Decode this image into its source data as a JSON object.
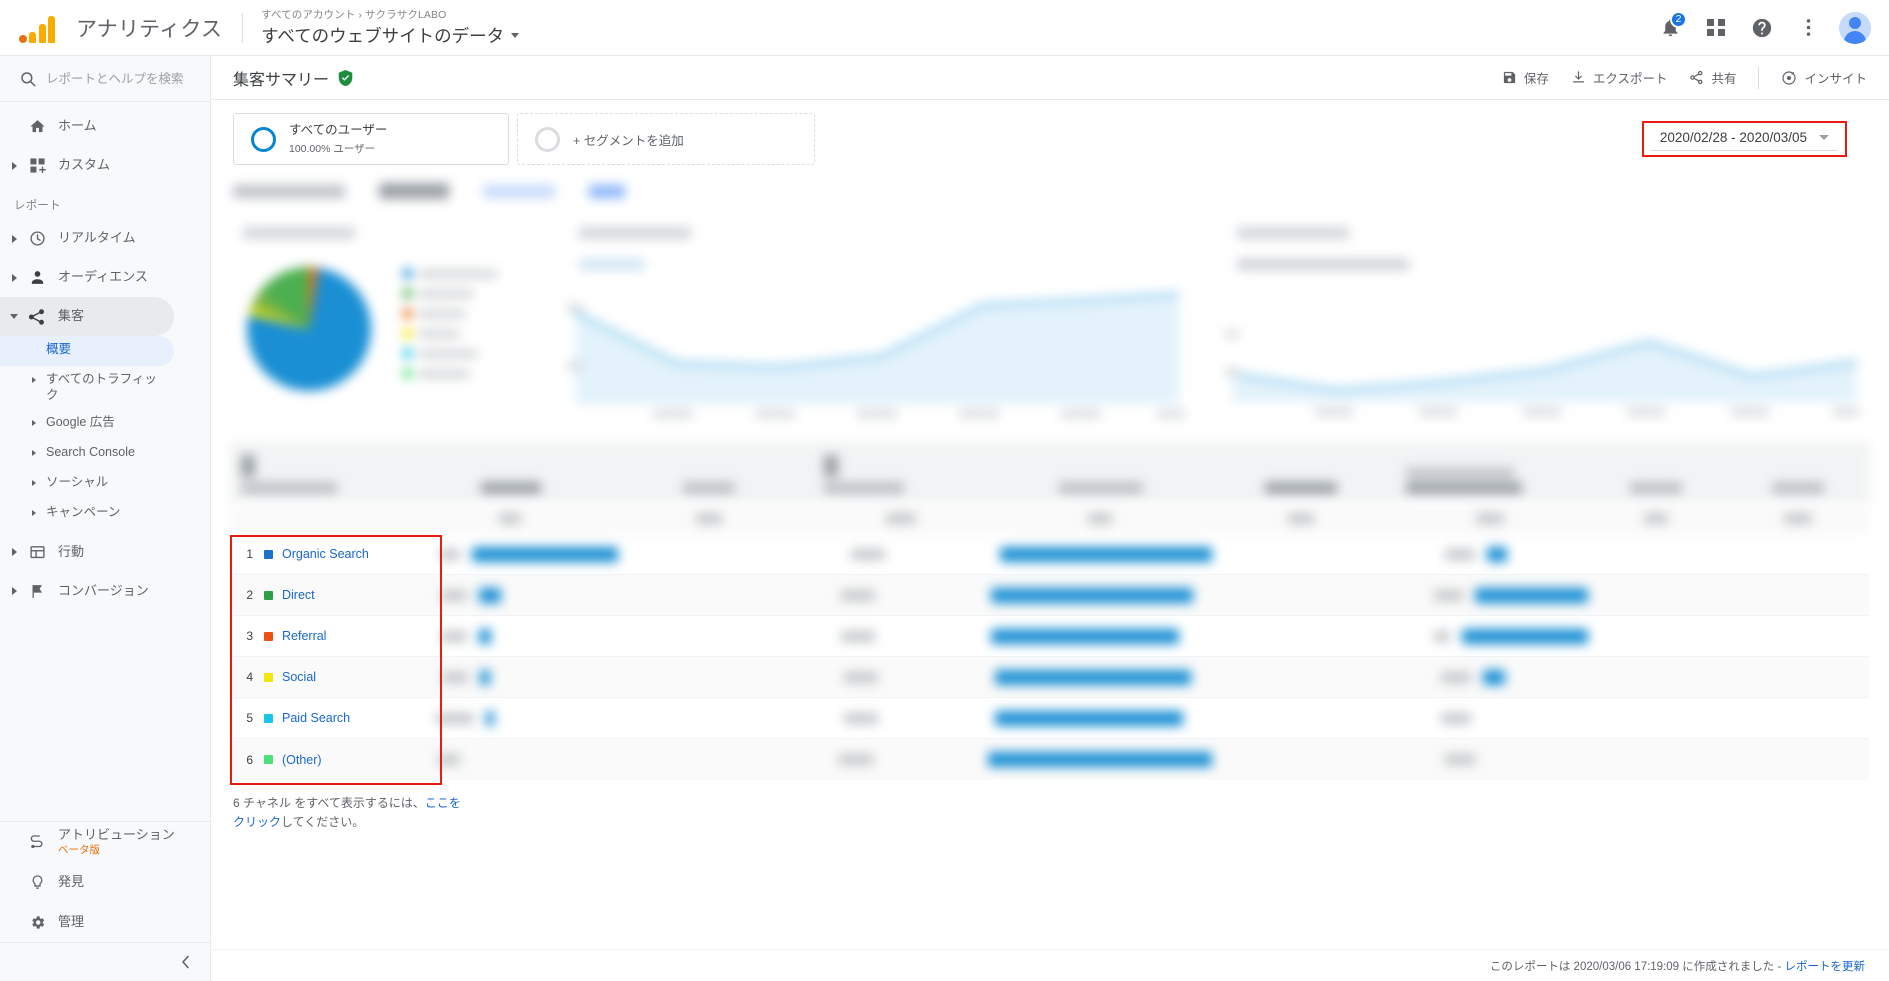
{
  "topbar": {
    "brand": "アナリティクス",
    "breadcrumb_all_accounts": "すべてのアカウント",
    "breadcrumb_sep": "›",
    "breadcrumb_account": "サクラサクLABO",
    "view_name": "すべてのウェブサイトのデータ",
    "notification_count": "2",
    "icons": {
      "notifications": "bell-icon",
      "apps": "apps-grid-icon",
      "help": "help-icon",
      "more": "more-vert-icon",
      "account": "avatar"
    }
  },
  "sidebar": {
    "search_placeholder": "レポートとヘルプを検索",
    "top_items": [
      {
        "label": "ホーム",
        "icon": "home-icon",
        "expandable": false
      },
      {
        "label": "カスタム",
        "icon": "custom-icon",
        "expandable": true
      }
    ],
    "section_label": "レポート",
    "report_items": [
      {
        "label": "リアルタイム",
        "icon": "clock-icon",
        "expandable": true,
        "expanded": false
      },
      {
        "label": "オーディエンス",
        "icon": "person-icon",
        "expandable": true,
        "expanded": false
      },
      {
        "label": "集客",
        "icon": "acquisition-icon",
        "expandable": true,
        "expanded": true,
        "active": true
      },
      {
        "label": "行動",
        "icon": "behavior-icon",
        "expandable": true,
        "expanded": false
      },
      {
        "label": "コンバージョン",
        "icon": "flag-icon",
        "expandable": true,
        "expanded": false
      }
    ],
    "acquisition_subitems": [
      {
        "label": "概要",
        "selected": true,
        "expandable": false
      },
      {
        "label": "すべてのトラフィック",
        "selected": false,
        "expandable": true
      },
      {
        "label": "Google 広告",
        "selected": false,
        "expandable": true
      },
      {
        "label": "Search Console",
        "selected": false,
        "expandable": true
      },
      {
        "label": "ソーシャル",
        "selected": false,
        "expandable": true
      },
      {
        "label": "キャンペーン",
        "selected": false,
        "expandable": true
      }
    ],
    "bottom_items": [
      {
        "label": "アトリビューション",
        "badge": "ベータ版",
        "icon": "attribution-icon"
      },
      {
        "label": "発見",
        "badge": "",
        "icon": "bulb-icon"
      },
      {
        "label": "管理",
        "badge": "",
        "icon": "gear-icon"
      }
    ],
    "collapse_icon": "chevron-left-icon"
  },
  "report": {
    "title": "集客サマリー",
    "verified_icon": "verified-shield-icon",
    "actions": [
      {
        "label": "保存",
        "icon": "save-icon"
      },
      {
        "label": "エクスポート",
        "icon": "export-icon"
      },
      {
        "label": "共有",
        "icon": "share-icon"
      },
      {
        "label": "インサイト",
        "icon": "insights-icon"
      }
    ]
  },
  "segments": {
    "applied": {
      "title": "すべてのユーザー",
      "subtitle": "100.00% ユーザー"
    },
    "add_label": "+ セグメントを追加"
  },
  "date_range": {
    "value": "2020/02/28 - 2020/03/05",
    "highlighted": true,
    "highlight_color": "#ea1c0d",
    "caret_icon": "chevron-down-icon"
  },
  "channel_list": {
    "highlighted": true,
    "highlight_color": "#ea1c0d",
    "rows": [
      {
        "rank": "1",
        "name": "Organic Search",
        "color": "#1a73c8"
      },
      {
        "rank": "2",
        "name": "Direct",
        "color": "#2e9e47"
      },
      {
        "rank": "3",
        "name": "Referral",
        "color": "#ec5014"
      },
      {
        "rank": "4",
        "name": "Social",
        "color": "#f2e60a"
      },
      {
        "rank": "5",
        "name": "Paid Search",
        "color": "#1ac6e8"
      },
      {
        "rank": "6",
        "name": "(Other)",
        "color": "#4ce07a"
      }
    ]
  },
  "footer_note": {
    "prefix": "6 チャネル をすべて表示するには、",
    "link": "ここをクリック",
    "suffix": "してください。"
  },
  "report_footer": {
    "text": "このレポートは 2020/03/06 17:19:09 に作成されました -",
    "link": "レポートを更新"
  },
  "chart_data": [
    {
      "type": "pie",
      "title": "",
      "note": "obscured/blurred in screenshot",
      "categories": [
        "Organic Search",
        "Direct",
        "Referral",
        "Social",
        "Paid Search",
        "(Other)"
      ],
      "values": [
        76,
        14,
        5,
        3,
        1,
        1
      ],
      "colors": [
        "#1a8fd4",
        "#4caf50",
        "#ec7014",
        "#f2e60a",
        "#1ac6e8",
        "#4ce07a"
      ],
      "legend_position": "right"
    },
    {
      "type": "area",
      "title": "",
      "note": "obscured/blurred in screenshot",
      "x": [
        "1",
        "2",
        "3",
        "4",
        "5",
        "6",
        "7"
      ],
      "values": [
        62,
        30,
        28,
        33,
        70,
        74,
        78
      ],
      "line_color": "#8ecdf0",
      "fill_color": "#e3f2fb",
      "grid": false
    },
    {
      "type": "area",
      "title": "",
      "note": "obscured/blurred in screenshot",
      "x": [
        "1",
        "2",
        "3",
        "4",
        "5",
        "6",
        "7"
      ],
      "values": [
        22,
        13,
        18,
        24,
        55,
        26,
        35
      ],
      "line_color": "#8ecdf0",
      "fill_color": "#e3f2fb",
      "grid": false
    }
  ]
}
